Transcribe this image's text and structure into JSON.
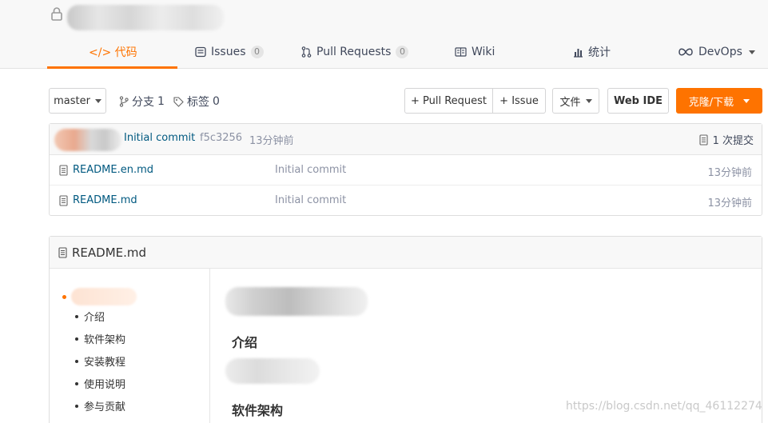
{
  "header": {
    "tabs": [
      {
        "label": "</> 代码",
        "icon": "code-icon"
      },
      {
        "label": "Issues",
        "count": "0",
        "icon": "issues-icon"
      },
      {
        "label": "Pull Requests",
        "count": "0",
        "icon": "pull-request-icon"
      },
      {
        "label": "Wiki",
        "icon": "wiki-icon"
      },
      {
        "label": "统计",
        "icon": "stats-icon"
      },
      {
        "label": "DevOps",
        "icon": "devops-icon"
      }
    ]
  },
  "toolbar": {
    "branch": "master",
    "branches_label": "分支",
    "branches_count": "1",
    "tags_label": "标签",
    "tags_count": "0",
    "new_pr": "+ Pull Request",
    "new_issue": "+ Issue",
    "file_menu": "文件",
    "web_ide": "Web IDE",
    "clone": "克隆/下载"
  },
  "latest_commit": {
    "message": "Initial commit",
    "hash": "f5c3256",
    "time": "13分钟前",
    "commits_label": "1 次提交"
  },
  "files": [
    {
      "name": "README.en.md",
      "commit": "Initial commit",
      "time": "13分钟前"
    },
    {
      "name": "README.md",
      "commit": "Initial commit",
      "time": "13分钟前"
    }
  ],
  "readme": {
    "title": "README.md",
    "toc": [
      "介绍",
      "软件架构",
      "安装教程",
      "使用说明",
      "参与贡献"
    ],
    "headings": [
      "介绍",
      "软件架构"
    ]
  },
  "watermark": "https://blog.csdn.net/qq_46112274",
  "colors": {
    "accent": "#fe7300",
    "link": "#005980"
  }
}
